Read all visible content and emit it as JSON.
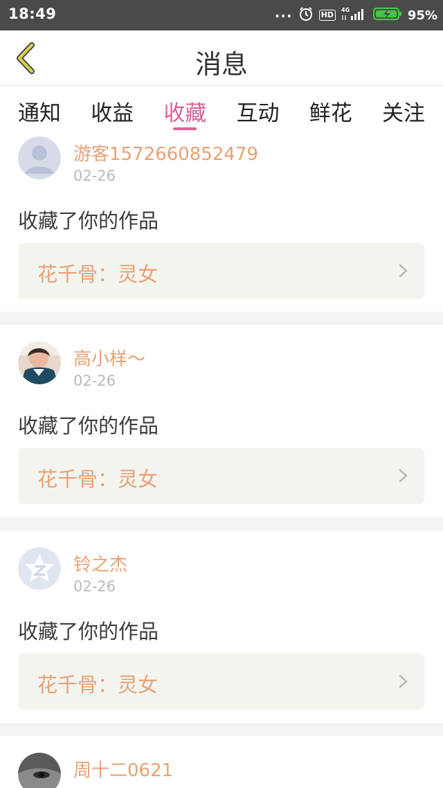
{
  "status_bar": {
    "time": "18:49",
    "dots": "...",
    "alarm_icon": "alarm-clock-icon",
    "hd_label": "HD",
    "network_label": "4G",
    "battery_text": "95%",
    "battery_color": "#47c447"
  },
  "header": {
    "back_icon": "chevron-left-icon",
    "back_color": "#c9c241",
    "title": "消息"
  },
  "tabs": [
    {
      "label": "通知",
      "active": false
    },
    {
      "label": "收益",
      "active": false
    },
    {
      "label": "收藏",
      "active": true
    },
    {
      "label": "互动",
      "active": false
    },
    {
      "label": "鲜花",
      "active": false
    },
    {
      "label": "关注",
      "active": false
    }
  ],
  "accent_color": "#d9619a",
  "username_color": "#e8a174",
  "feed": [
    {
      "username": "游客1572660852479",
      "date": "02-26",
      "action": "收藏了你的作品",
      "work_title": "花千骨：灵女",
      "avatar": "default-user-avatar"
    },
    {
      "username": "高小样～",
      "date": "02-26",
      "action": "收藏了你的作品",
      "work_title": "花千骨：灵女",
      "avatar": "photo-avatar"
    },
    {
      "username": "铃之杰",
      "date": "02-26",
      "action": "收藏了你的作品",
      "work_title": "花千骨：灵女",
      "avatar": "qzone-star-avatar"
    },
    {
      "username": "周十二0621",
      "date": "",
      "action": "",
      "work_title": "",
      "avatar": "photo-avatar"
    }
  ]
}
